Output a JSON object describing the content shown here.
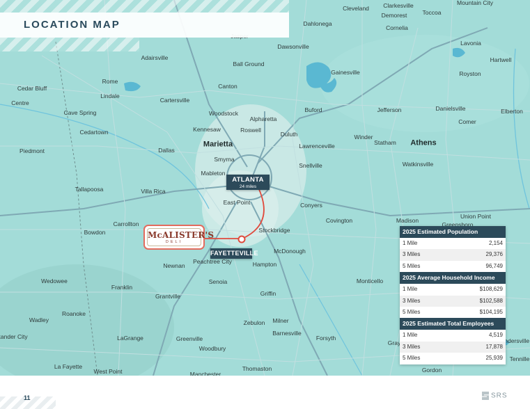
{
  "title": "LOCATION MAP",
  "page_number": "11",
  "brand": "SRS",
  "colors": {
    "map_bg": "#9fd9d6",
    "panel_dark": "#2c4a5a",
    "accent_red": "#e04a3c"
  },
  "cities": [
    {
      "name": "Cleveland"
    },
    {
      "name": "Clarkesville"
    },
    {
      "name": "Demorest"
    },
    {
      "name": "Toccoa"
    },
    {
      "name": "Dahlonega"
    },
    {
      "name": "Cornelia"
    },
    {
      "name": "Lavonia"
    },
    {
      "name": "Jasper"
    },
    {
      "name": "Dawsonville"
    },
    {
      "name": "Adairsville"
    },
    {
      "name": "Ball Ground"
    },
    {
      "name": "Hartwell"
    },
    {
      "name": "Gainesville"
    },
    {
      "name": "Royston"
    },
    {
      "name": "Rome"
    },
    {
      "name": "Canton"
    },
    {
      "name": "Cedar Bluff"
    },
    {
      "name": "Lindale"
    },
    {
      "name": "Cartersville"
    },
    {
      "name": "Centre"
    },
    {
      "name": "Cave Spring"
    },
    {
      "name": "Woodstock"
    },
    {
      "name": "Alpharetta"
    },
    {
      "name": "Buford"
    },
    {
      "name": "Jefferson"
    },
    {
      "name": "Danielsville"
    },
    {
      "name": "Elberton"
    },
    {
      "name": "Comer"
    },
    {
      "name": "Kennesaw"
    },
    {
      "name": "Roswell"
    },
    {
      "name": "Cedartown"
    },
    {
      "name": "Duluth"
    },
    {
      "name": "Winder"
    },
    {
      "name": "Piedmont"
    },
    {
      "name": "Marietta",
      "major": true
    },
    {
      "name": "Dallas"
    },
    {
      "name": "Lawrenceville"
    },
    {
      "name": "Statham"
    },
    {
      "name": "Athens",
      "major": true
    },
    {
      "name": "Smyrna"
    },
    {
      "name": "Snellville"
    },
    {
      "name": "Watkinsville"
    },
    {
      "name": "Mableton"
    },
    {
      "name": "Tallapoosa"
    },
    {
      "name": "Villa Rica"
    },
    {
      "name": "East Point"
    },
    {
      "name": "Conyers"
    },
    {
      "name": "Covington"
    },
    {
      "name": "Madison"
    },
    {
      "name": "Union Point"
    },
    {
      "name": "Carrollton"
    },
    {
      "name": "Greensboro"
    },
    {
      "name": "Bowdon"
    },
    {
      "name": "Stockbridge"
    },
    {
      "name": "McDonough"
    },
    {
      "name": "Peachtree City"
    },
    {
      "name": "Newnan"
    },
    {
      "name": "Hampton"
    },
    {
      "name": "Wedowee"
    },
    {
      "name": "Franklin"
    },
    {
      "name": "Senoia"
    },
    {
      "name": "Monticello"
    },
    {
      "name": "Grantville"
    },
    {
      "name": "Griffin"
    },
    {
      "name": "Roanoke"
    },
    {
      "name": "Wadley"
    },
    {
      "name": "Zebulon"
    },
    {
      "name": "Milner"
    },
    {
      "name": "LaGrange"
    },
    {
      "name": "Greenville"
    },
    {
      "name": "Barnesville"
    },
    {
      "name": "Forsyth"
    },
    {
      "name": "Woodbury"
    },
    {
      "name": "La Fayette"
    },
    {
      "name": "West Point"
    },
    {
      "name": "Thomaston"
    },
    {
      "name": "Manchester"
    },
    {
      "name": "Gordon"
    },
    {
      "name": "Sandersville"
    },
    {
      "name": "Tennille"
    },
    {
      "name": "Mountain City"
    },
    {
      "name": "Gray"
    },
    {
      "name": "Alexander City"
    }
  ],
  "markers": {
    "atlanta": {
      "name": "ATLANTA",
      "distance": "24 miles"
    },
    "site": {
      "name": "FAYETTEVILLE"
    }
  },
  "logo": {
    "name": "McALISTER'S",
    "sub": "DELI"
  },
  "stats": [
    {
      "heading": "2025 Estimated Population",
      "rows": [
        {
          "label": "1 Mile",
          "value": "2,154"
        },
        {
          "label": "3 Miles",
          "value": "29,376"
        },
        {
          "label": "5 Miles",
          "value": "96,749"
        }
      ]
    },
    {
      "heading": "2025 Average Household Income",
      "rows": [
        {
          "label": "1 Mile",
          "value": "$108,629"
        },
        {
          "label": "3 Miles",
          "value": "$102,588"
        },
        {
          "label": "5 Miles",
          "value": "$104,195"
        }
      ]
    },
    {
      "heading": "2025 Estimated Total Employees",
      "rows": [
        {
          "label": "1 Mile",
          "value": "4,519"
        },
        {
          "label": "3 Miles",
          "value": "17,878"
        },
        {
          "label": "5 Miles",
          "value": "25,939"
        }
      ]
    }
  ]
}
